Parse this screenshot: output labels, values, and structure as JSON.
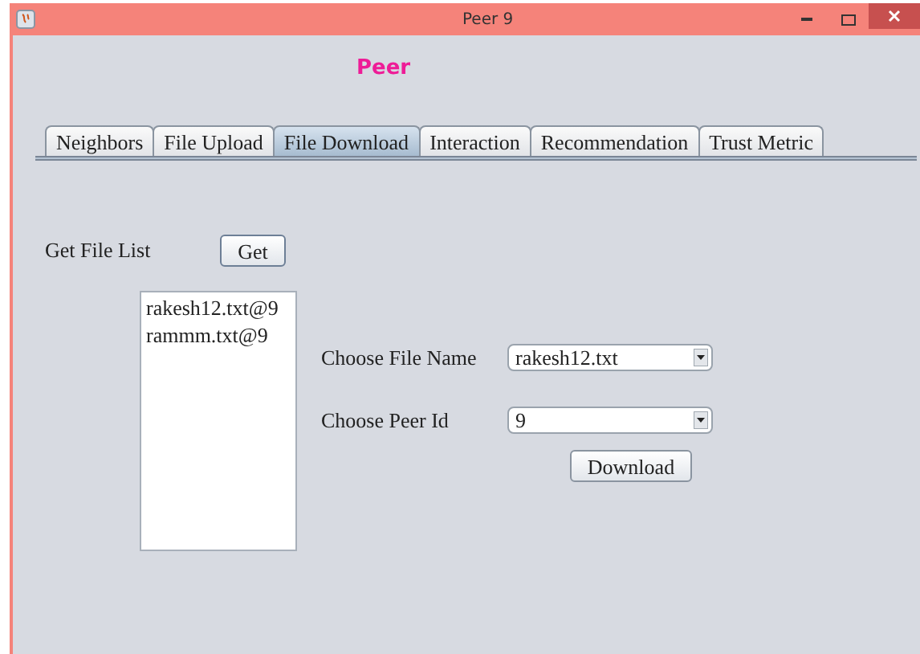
{
  "window": {
    "title": "Peer 9"
  },
  "heading": "Peer",
  "tabs": [
    {
      "label": "Neighbors",
      "selected": false
    },
    {
      "label": "File Upload",
      "selected": false
    },
    {
      "label": "File Download",
      "selected": true
    },
    {
      "label": "Interaction",
      "selected": false
    },
    {
      "label": "Recommendation",
      "selected": false
    },
    {
      "label": "Trust Metric",
      "selected": false
    }
  ],
  "file_list": {
    "label": "Get File List",
    "button": "Get",
    "items": [
      "rakesh12.txt@9",
      "rammm.txt@9"
    ]
  },
  "file_name": {
    "label": "Choose File Name",
    "value": "rakesh12.txt"
  },
  "peer_id": {
    "label": "Choose Peer Id",
    "value": "9"
  },
  "download_button": "Download"
}
